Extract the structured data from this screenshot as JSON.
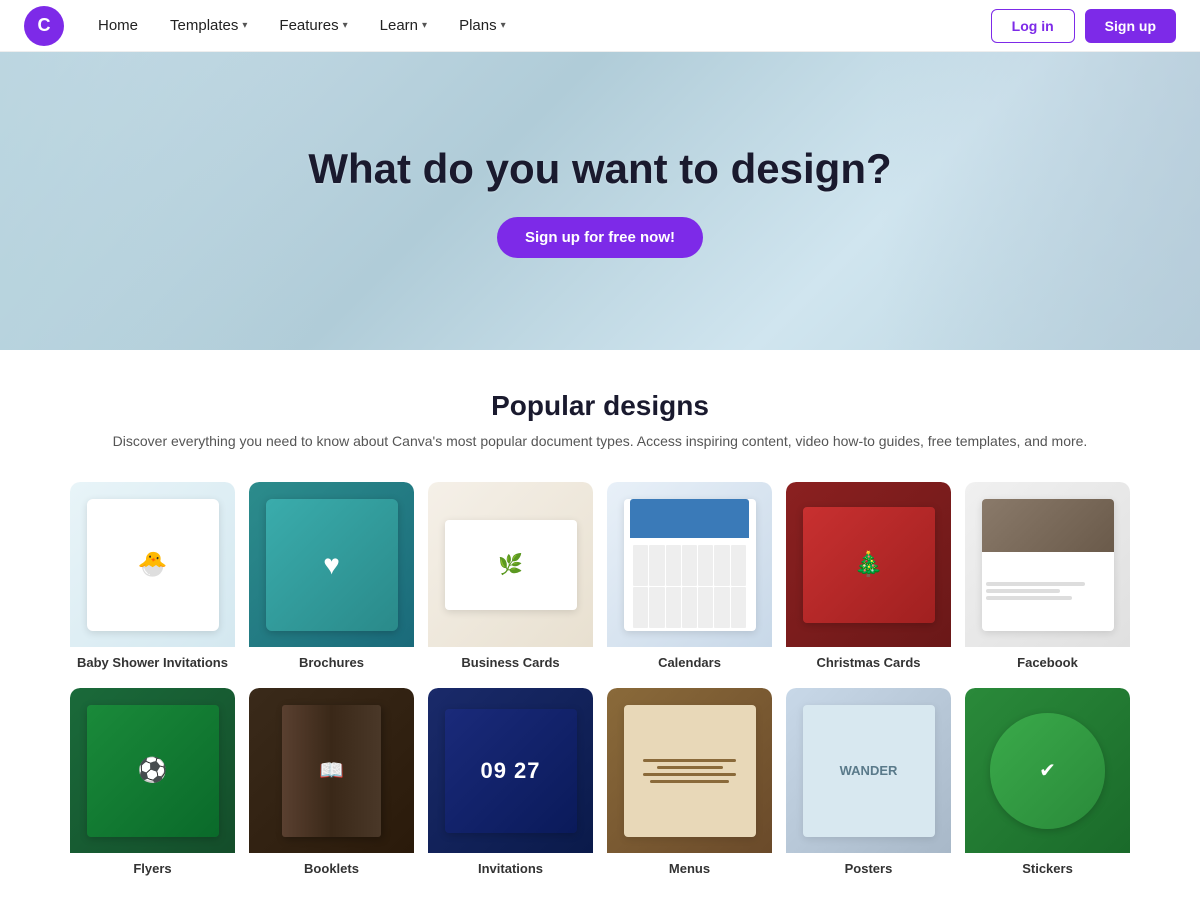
{
  "nav": {
    "logo_text": "C",
    "home_label": "Home",
    "templates_label": "Templates",
    "features_label": "Features",
    "learn_label": "Learn",
    "plans_label": "Plans",
    "login_label": "Log in",
    "signup_label": "Sign up"
  },
  "hero": {
    "title": "What do you want to design?",
    "cta_label": "Sign up for free now!"
  },
  "popular": {
    "title": "Popular designs",
    "subtitle": "Discover everything you need to know about Canva's most popular document types. Access\ninspiring content, video how-to guides, free templates, and more.",
    "row1": [
      {
        "id": "baby-shower",
        "label": "Baby Shower Invitations",
        "theme": "baby"
      },
      {
        "id": "brochures",
        "label": "Brochures",
        "theme": "brochure"
      },
      {
        "id": "business-cards",
        "label": "Business Cards",
        "theme": "business"
      },
      {
        "id": "calendars",
        "label": "Calendars",
        "theme": "calendar"
      },
      {
        "id": "christmas-cards",
        "label": "Christmas Cards",
        "theme": "christmas"
      },
      {
        "id": "facebook",
        "label": "Facebook",
        "theme": "facebook"
      }
    ],
    "row2": [
      {
        "id": "flyers",
        "label": "Flyers",
        "theme": "flyer"
      },
      {
        "id": "booklets",
        "label": "Booklets",
        "theme": "book"
      },
      {
        "id": "invitations",
        "label": "Invitations",
        "theme": "invitation"
      },
      {
        "id": "menus",
        "label": "Menus",
        "theme": "menu"
      },
      {
        "id": "posters",
        "label": "Posters",
        "theme": "poster"
      },
      {
        "id": "stickers",
        "label": "Stickers",
        "theme": "sticker"
      }
    ]
  }
}
